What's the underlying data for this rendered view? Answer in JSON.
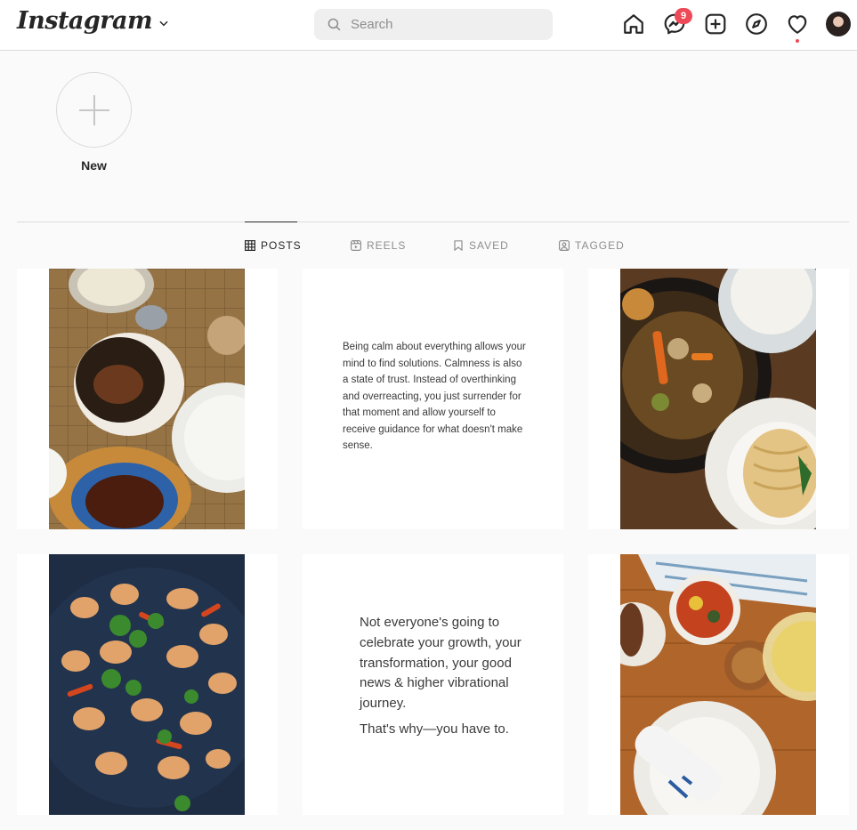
{
  "header": {
    "logo": "Instagram",
    "search_placeholder": "Search",
    "messages_badge": "9"
  },
  "highlights": {
    "new_label": "New"
  },
  "tabs": [
    {
      "label": "POSTS",
      "icon": "grid-icon",
      "active": true
    },
    {
      "label": "REELS",
      "icon": "reels-icon",
      "active": false
    },
    {
      "label": "SAVED",
      "icon": "bookmark-icon",
      "active": false
    },
    {
      "label": "TAGGED",
      "icon": "tagged-icon",
      "active": false
    }
  ],
  "posts": [
    {
      "type": "photo",
      "subject": "food spread with rice and braised meat"
    },
    {
      "type": "quote",
      "text": "Being calm about everything allows your mind to find solutions. Calmness is also a state of trust. Instead of overthinking and overreacting, you just surrender for that moment and allow yourself to receive guidance for what doesn't make sense."
    },
    {
      "type": "photo",
      "subject": "stew with vegetables, rice and pasta"
    },
    {
      "type": "photo",
      "subject": "shrimp stir fry with cilantro"
    },
    {
      "type": "quote",
      "text": "Not everyone's going to celebrate your growth, your transformation, your good news & higher vibrational journey.",
      "text_last": "That's why—you have to."
    },
    {
      "type": "photo",
      "subject": "table with plates, paella and drink"
    }
  ],
  "colors": {
    "accent_red": "#ed4956",
    "border": "#dbdbdb",
    "text": "#262626",
    "muted": "#8e8e8e",
    "background": "#fafafa"
  }
}
